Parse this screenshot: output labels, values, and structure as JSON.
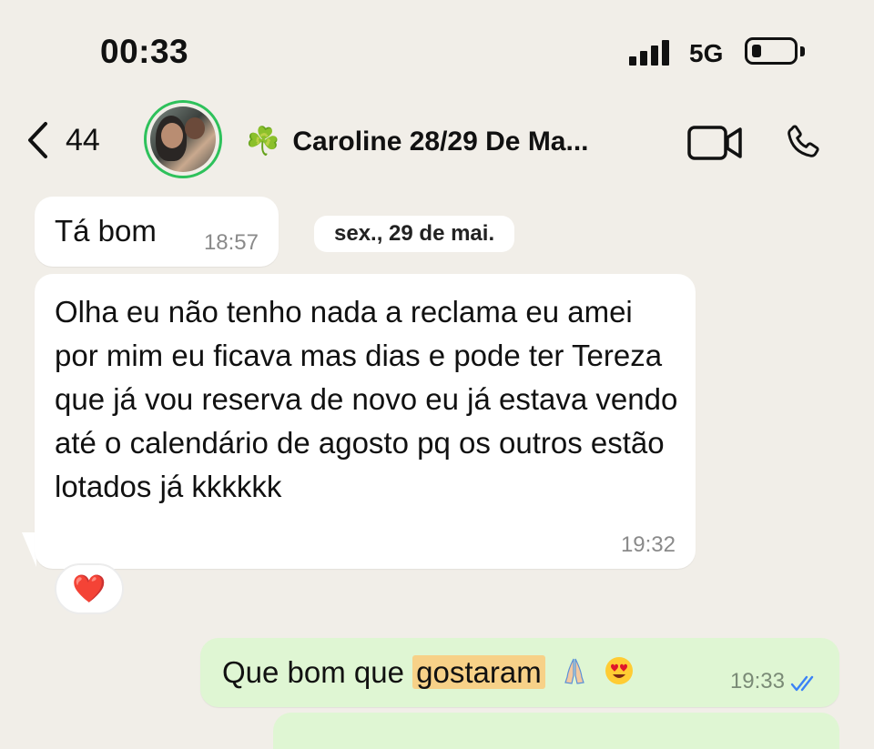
{
  "status_bar": {
    "time": "00:33",
    "network": "5G",
    "signal_icon": "cellular-signal-icon",
    "battery_icon": "battery-low-icon"
  },
  "header": {
    "back_count": "44",
    "contact_prefix_emoji": "☘️",
    "contact_name": "Caroline 28/29 De Ma...",
    "video_icon": "video-call-icon",
    "call_icon": "phone-call-icon"
  },
  "messages": [
    {
      "type": "incoming",
      "text": "Tá bom",
      "time": "18:57"
    },
    {
      "type": "date",
      "text": "sex., 29 de mai."
    },
    {
      "type": "incoming",
      "text": "Olha eu não tenho nada a reclama eu amei por mim eu ficava mas dias e pode ter Tereza que já vou reserva de novo eu já estava vendo até o calendário de agosto pq os outros estão lotados já kkkkkk",
      "time": "19:32",
      "reaction": "❤️"
    },
    {
      "type": "outgoing",
      "text_before": "Que bom que ",
      "text_highlight": "gostaram",
      "time": "19:33"
    }
  ],
  "colors": {
    "background": "#f1eee8",
    "incoming_bubble": "#ffffff",
    "outgoing_bubble": "#dff6d3",
    "highlight": "#f7d188",
    "read_ticks": "#3b82f6",
    "avatar_ring": "#2ec15b"
  }
}
